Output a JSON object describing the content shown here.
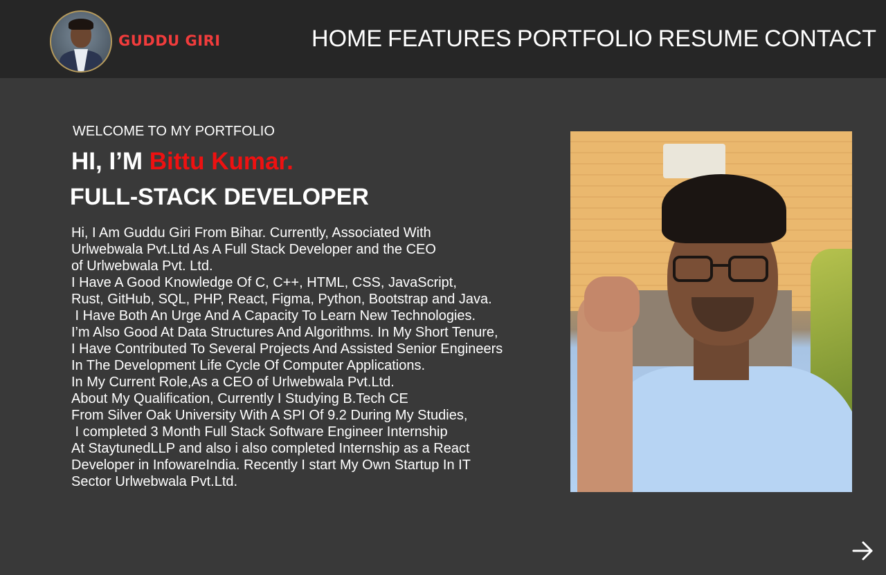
{
  "header": {
    "brand_name": "GUDDU GIRI",
    "nav": {
      "home": "HOME",
      "features": "FEATURES",
      "portfolio": "PORTFOLIO",
      "resume": "RESUME",
      "contact": "CONTACT"
    }
  },
  "hero": {
    "welcome": "WELCOME TO MY PORTFOLIO",
    "greeting_prefix": "HI, I’M ",
    "greeting_name": "Bittu Kumar.",
    "role": "FULL-STACK DEVELOPER",
    "bio_lines": [
      "Hi, I Am Guddu Giri From Bihar. Currently, Associated With",
      "Urlwebwala Pvt.Ltd As A Full Stack Developer and the CEO",
      "of Urlwebwala Pvt. Ltd.",
      "I Have A Good Knowledge Of C, C++, HTML, CSS, JavaScript,",
      "Rust, GitHub, SQL, PHP, React, Figma, Python, Bootstrap and Java.",
      " I Have Both An Urge And A Capacity To Learn New Technologies.",
      "I’m Also Good At Data Structures And Algorithms. In My Short Tenure,",
      "I Have Contributed To Several Projects And Assisted Senior Engineers",
      "In The Development Life Cycle Of Computer Applications.",
      "In My Current Role,As a CEO of Urlwebwala Pvt.Ltd.",
      "About My Qualification, Currently I Studying B.Tech CE",
      "From Silver Oak University With A SPI Of 9.2 During My Studies,",
      " I completed 3 Month Full Stack Software Engineer Internship",
      "At StaytunedLLP and also i also completed Internship as a React",
      "Developer in InfowareIndia. Recently I start My Own Startup In IT",
      "Sector Urlwebwala Pvt.Ltd."
    ]
  },
  "icons": {
    "next": "arrow-right-icon"
  },
  "colors": {
    "background": "#393939",
    "header": "#262626",
    "brand": "#f13c3c",
    "highlight": "#ee1111",
    "text": "#ffffff"
  }
}
